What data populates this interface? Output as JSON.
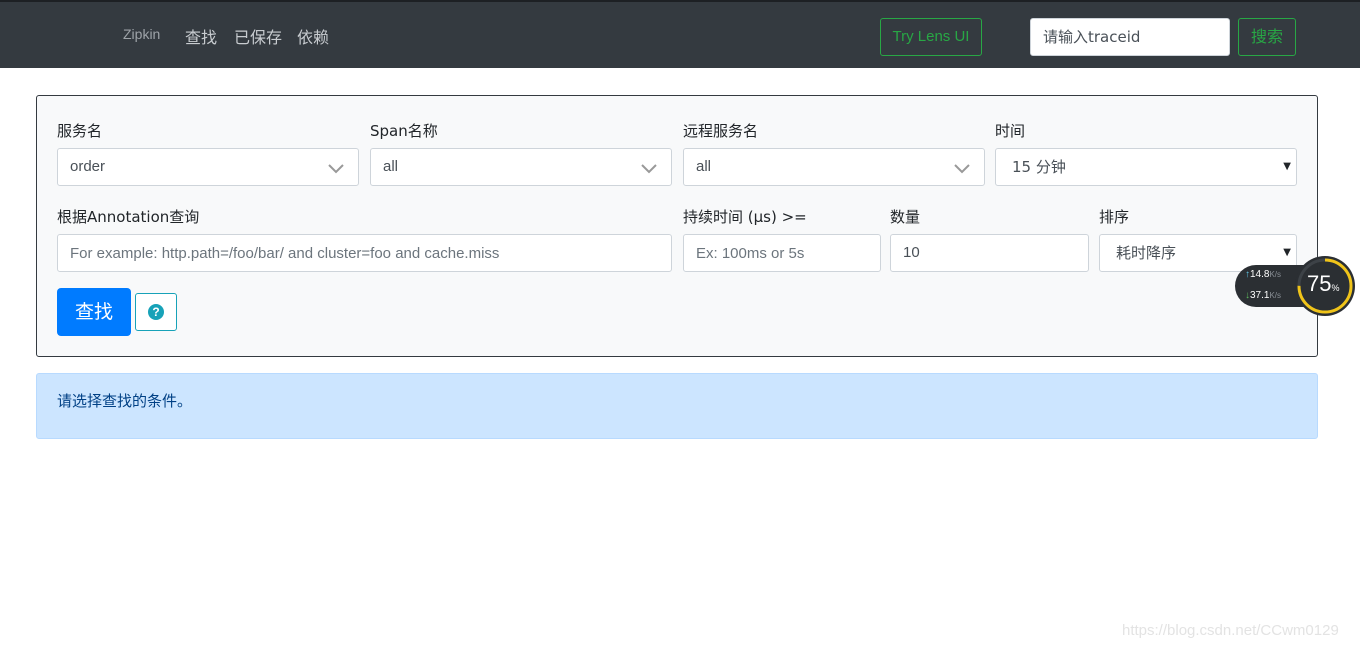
{
  "header": {
    "brand": "Zipkin",
    "nav": [
      "查找",
      "已保存",
      "依赖"
    ],
    "lens_button": "Try Lens UI",
    "traceid_placeholder": "请输入traceid",
    "search_button": "搜索"
  },
  "form": {
    "service_label": "服务名",
    "service_value": "order",
    "span_label": "Span名称",
    "span_value": "all",
    "remote_label": "远程服务名",
    "remote_value": "all",
    "time_label": "时间",
    "time_value": "15 分钟",
    "annotation_label": "根据Annotation查询",
    "annotation_placeholder": "For example: http.path=/foo/bar/ and cluster=foo and cache.miss",
    "duration_label": "持续时间 (μs) >=",
    "duration_placeholder": "Ex: 100ms or 5s",
    "limit_label": "数量",
    "limit_value": "10",
    "sort_label": "排序",
    "sort_value": "耗时降序",
    "find_button": "查找",
    "help_glyph": "?"
  },
  "alert": {
    "message": "请选择查找的条件。"
  },
  "net_widget": {
    "up": "14.8",
    "down": "37.1",
    "unit": "K/s",
    "percent": "75",
    "percent_sign": "%",
    "percent_value": 0.75
  },
  "watermark": "https://blog.csdn.net/CCwm0129",
  "colors": {
    "nav_bg": "#343a40",
    "accent_green": "#28a745",
    "primary": "#007bff",
    "info": "#17a2b8",
    "alert_bg": "#cce5ff"
  }
}
